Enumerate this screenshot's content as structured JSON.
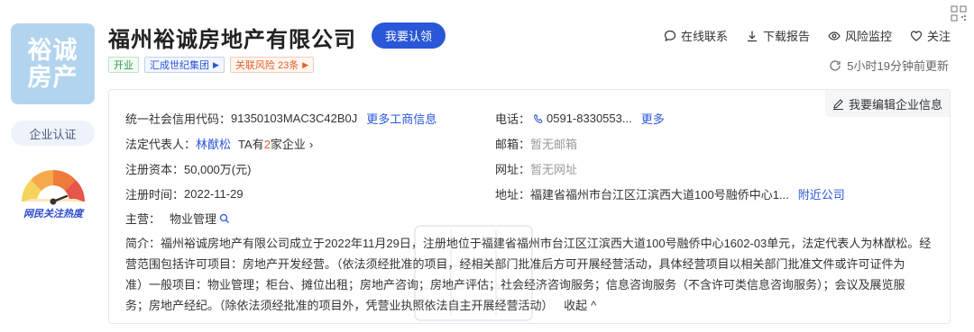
{
  "logo": {
    "line1": "裕诚",
    "line2": "房产"
  },
  "side": {
    "cert_label": "企业认证",
    "heat_label": "网民关注热度"
  },
  "company": {
    "name": "福州裕诚房地产有限公司",
    "claim_label": "我要认领"
  },
  "actions": {
    "online_contact": "在线联系",
    "download_report": "下载报告",
    "risk_monitor": "风险监控",
    "follow": "关注"
  },
  "tags": {
    "status": "开业",
    "group": "汇成世纪集团",
    "risk": "关联风险 23条"
  },
  "refresh": {
    "text": "5小时19分钟前更新"
  },
  "panel": {
    "edit_label": "我要编辑企业信息"
  },
  "info": {
    "credit_code_label": "统一社会信用代码：",
    "credit_code_value": "91350103MAC3C42B0J",
    "more_business": "更多工商信息",
    "legal_rep_label": "法定代表人：",
    "legal_rep_value": "林猷松",
    "ta_prefix": "TA有",
    "ta_count": "2",
    "ta_suffix": "家企业",
    "capital_label": "注册资本：",
    "capital_value": "50,000万(元)",
    "reg_time_label": "注册时间：",
    "reg_time_value": "2022-11-29",
    "main_business_label": "主营：",
    "main_business_value": "物业管理",
    "phone_label": "电话：",
    "phone_value": "0591-8330553...",
    "phone_more": "更多",
    "email_label": "邮箱：",
    "email_value": "暂无邮箱",
    "website_label": "网址：",
    "website_value": "暂无网址",
    "address_label": "地址：",
    "address_value": "福建省福州市台江区江滨西大道100号融侨中心1...",
    "nearby": "附近公司"
  },
  "intro": {
    "line1": "简介：福州裕诚房地产有限公司成立于2022年11月29日，注册地位于福建省福州市台江区江滨西大道100号融侨中心1602-03单元，法定代表人为林猷松。经",
    "line2": "营范围包括许可项目：房地产开发经营。（依法须经批准的项目，经相关部门批准后方可开展经营活动，具体经营项目以相关部门批准文件或许可证件为",
    "line3": "准）一般项目：物业管理；柜台、摊位出租；房地产咨询；房地产评估；社会经济咨询服务；信息咨询服务（不含许可类信息咨询服务）；会议及展览服",
    "line4": "务；房地产经纪。（除依法须经批准的项目外，凭营业执照依法自主开展经营活动）",
    "collapse": "收起"
  }
}
